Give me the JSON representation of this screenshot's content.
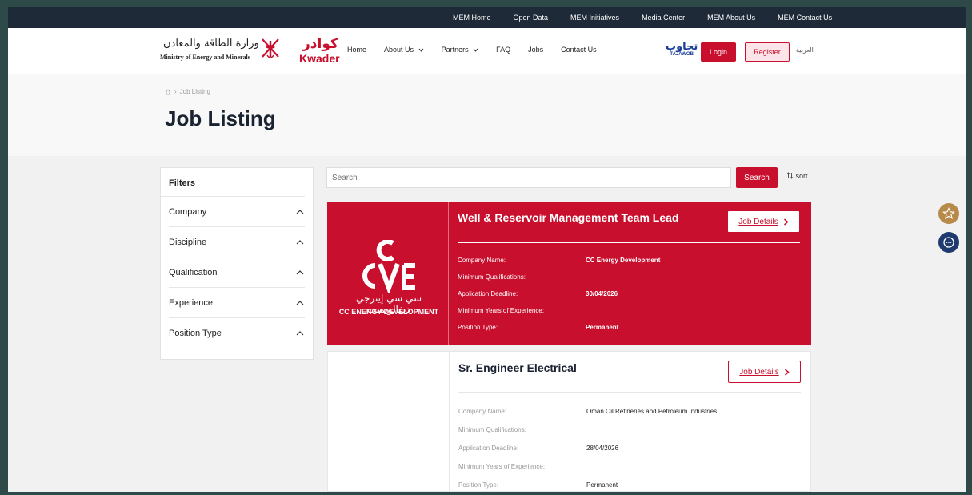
{
  "topbar": {
    "links": [
      "MEM Home",
      "Open Data",
      "MEM Initiatives",
      "Media Center",
      "MEM About Us",
      "MEM Contact Us"
    ]
  },
  "header": {
    "mem_logo_ar": "وزارة الطاقة والمعادن",
    "mem_logo_en": "Ministry of Energy and Minerals",
    "kwader_ar": "كوادر",
    "kwader_en": "Kwader",
    "nav": {
      "home": "Home",
      "about": "About Us",
      "partners": "Partners",
      "faq": "FAQ",
      "jobs": "Jobs",
      "contact": "Contact Us"
    },
    "tajawob_ar": "تجاوب",
    "tajawob_en": "TAJAWOB",
    "login": "Login",
    "register": "Register",
    "language": "العربية"
  },
  "breadcrumb": {
    "current": "Job Listing"
  },
  "page_title": "Job Listing",
  "filters": {
    "title": "Filters",
    "items": [
      "Company",
      "Discipline",
      "Qualification",
      "Experience",
      "Position Type"
    ]
  },
  "search": {
    "placeholder": "Search",
    "button": "Search",
    "sort": "sort"
  },
  "jobs": [
    {
      "title": "Well & Reservoir Management Team Lead",
      "details_label": "Job Details",
      "logo_letters": "CCE",
      "logo_ar": "سي سي إينرجي ديفالوبمنت",
      "logo_en": "CC ENERGY DEVELOPMENT",
      "fields": {
        "company_label": "Company Name:",
        "company": "CC Energy Development",
        "qualifications_label": "Minimum Qualifications:",
        "qualifications": "",
        "deadline_label": "Application Deadline:",
        "deadline": "30/04/2026",
        "experience_label": "Minimum Years of Experience:",
        "experience": "",
        "position_label": "Position Type:",
        "position": "Permanent"
      }
    },
    {
      "title": "Sr. Engineer Electrical",
      "details_label": "Job Details",
      "fields": {
        "company_label": "Company Name:",
        "company": "Oman Oil Refineries and Petroleum Industries",
        "qualifications_label": "Minimum Qualifications:",
        "qualifications": "",
        "deadline_label": "Application Deadline:",
        "deadline": "28/04/2026",
        "experience_label": "Minimum Years of Experience:",
        "experience": "",
        "position_label": "Position Type:",
        "position": "Permanent"
      }
    }
  ],
  "colors": {
    "brand_red": "#c8102e",
    "topbar": "#1f2a38",
    "favorite": "#b88a4a",
    "chat": "#1f3a6e"
  }
}
